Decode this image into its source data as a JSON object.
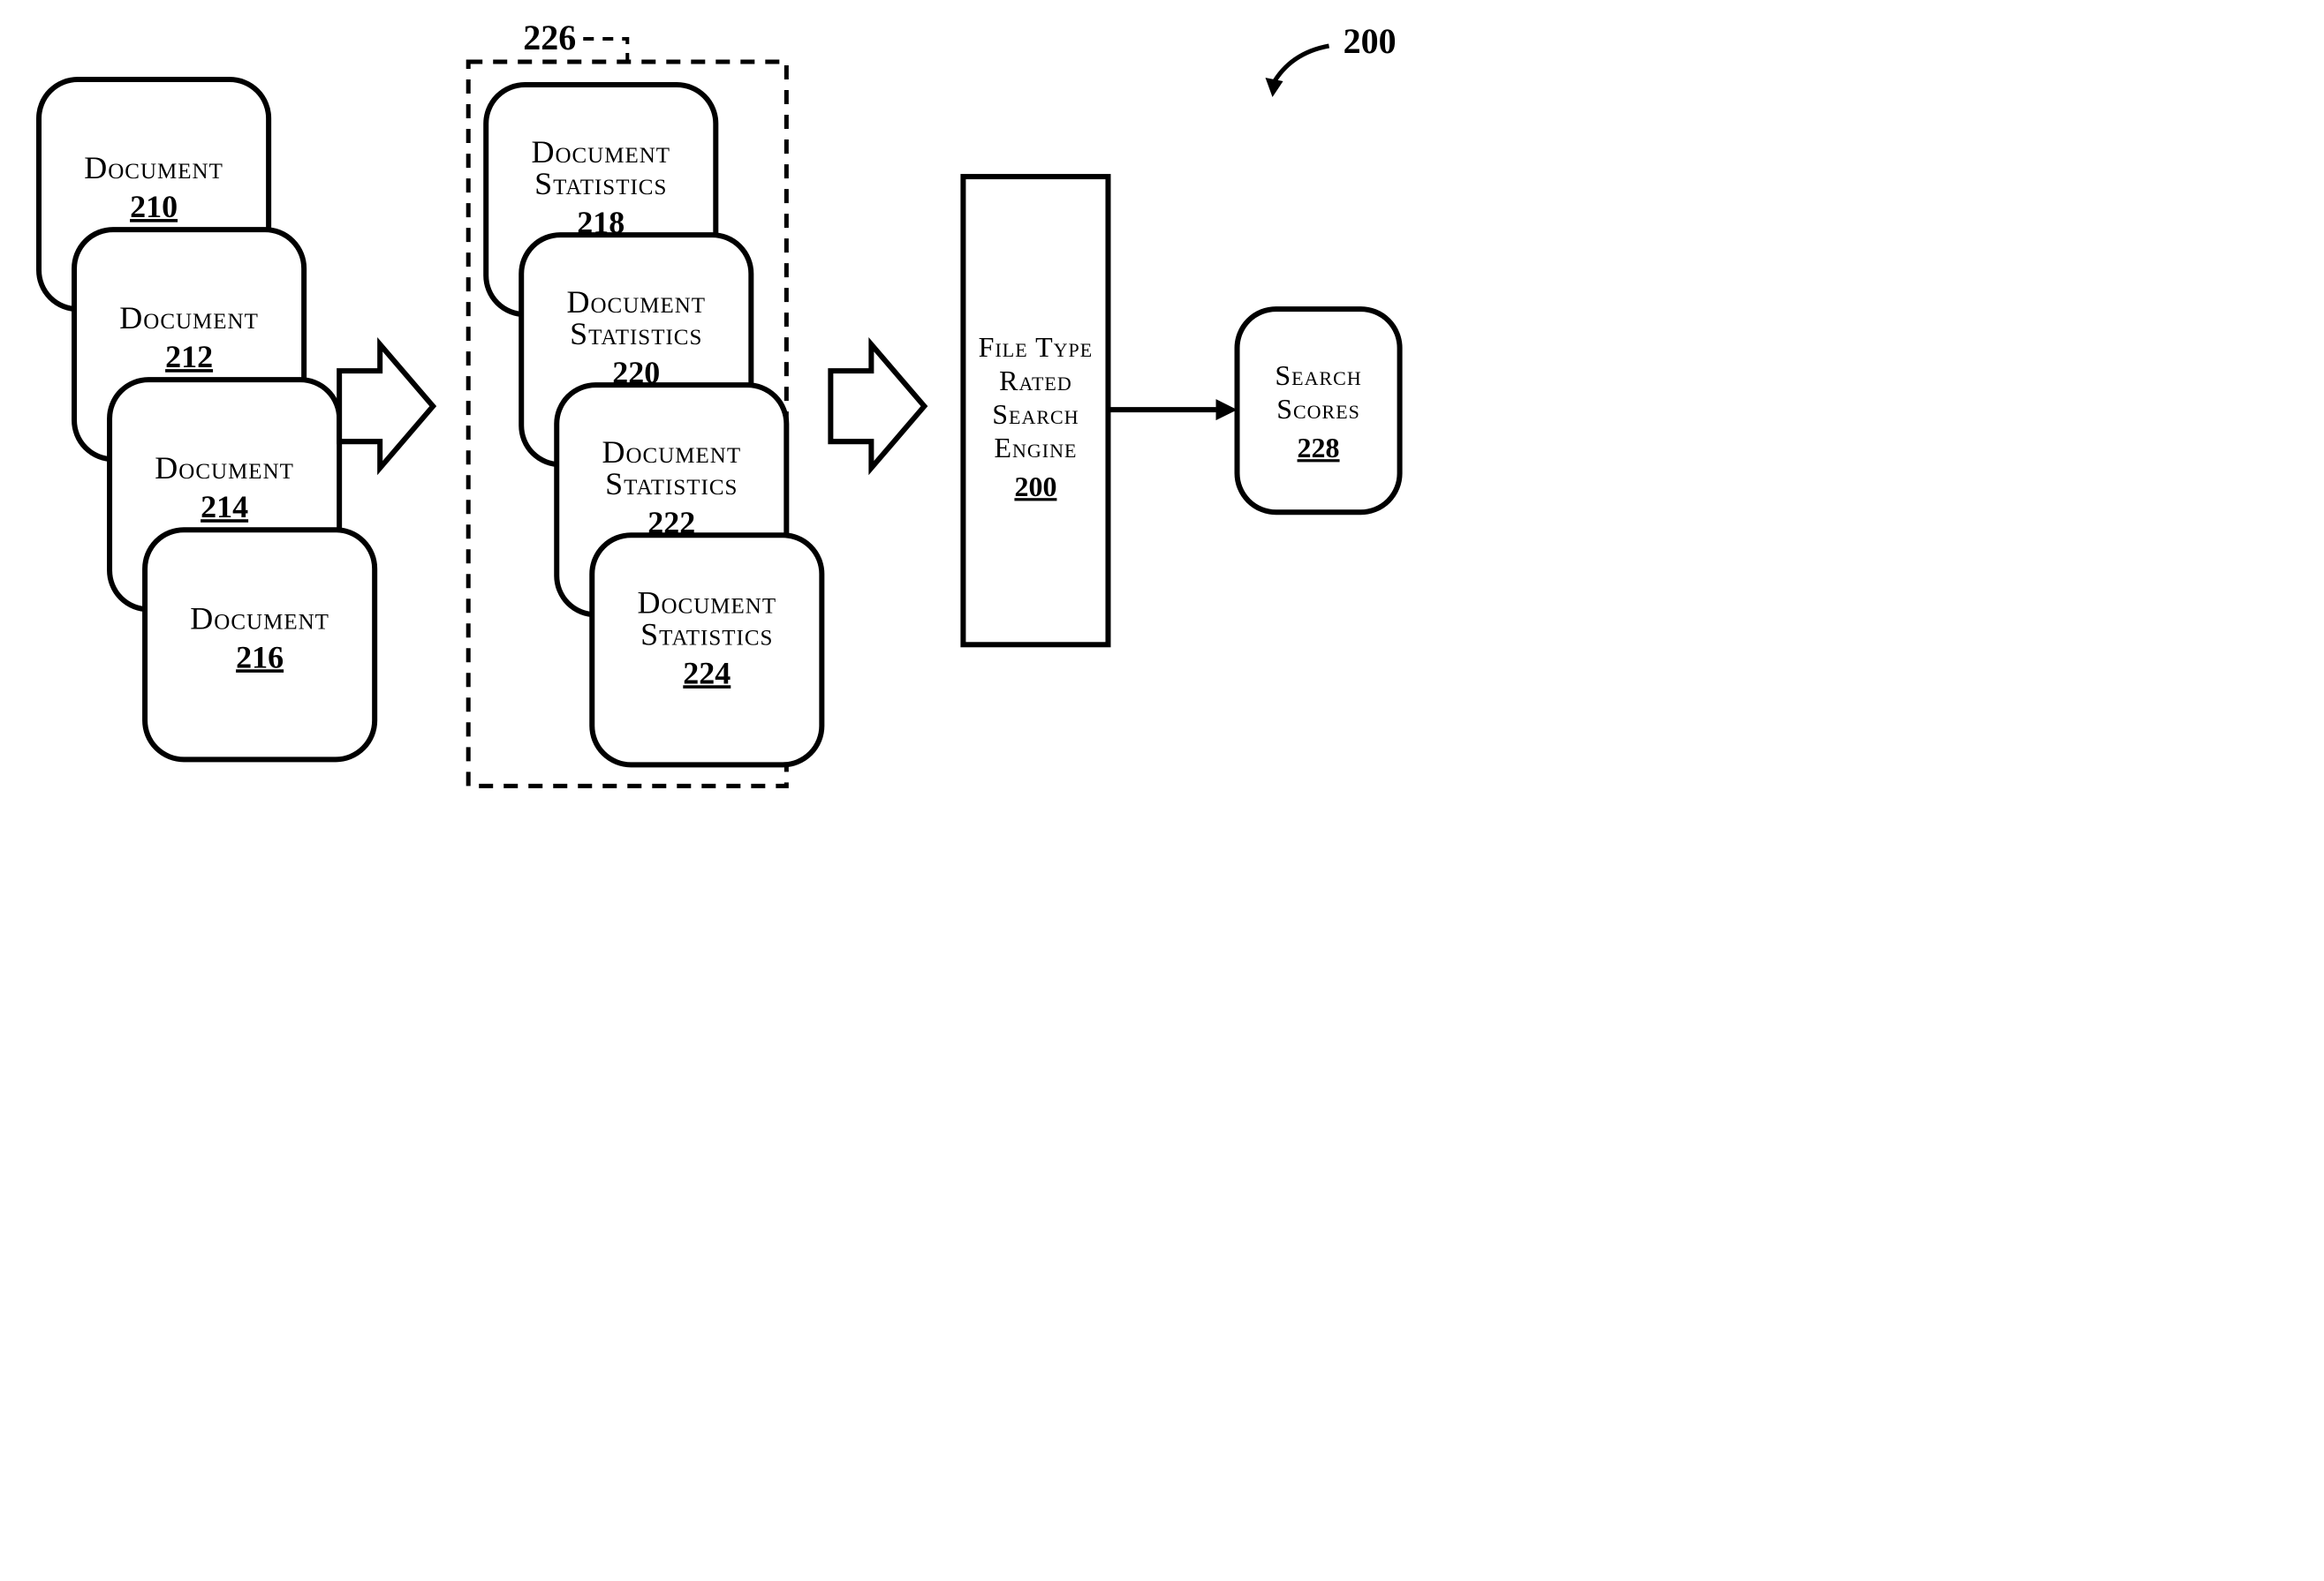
{
  "figure_ref_top": "200",
  "dashed_ref": "226",
  "documents": [
    {
      "label": "Document",
      "ref": "210"
    },
    {
      "label": "Document",
      "ref": "212"
    },
    {
      "label": "Document",
      "ref": "214"
    },
    {
      "label": "Document",
      "ref": "216"
    }
  ],
  "stats": [
    {
      "label1": "Document",
      "label2": "Statistics",
      "ref": "218"
    },
    {
      "label1": "Document",
      "label2": "Statistics",
      "ref": "220"
    },
    {
      "label1": "Document",
      "label2": "Statistics",
      "ref": "222"
    },
    {
      "label1": "Document",
      "label2": "Statistics",
      "ref": "224"
    }
  ],
  "engine": {
    "line1": "File Type",
    "line2": "Rated",
    "line3": "Search",
    "line4": "Engine",
    "ref": "200"
  },
  "output": {
    "line1": "Search",
    "line2": "Scores",
    "ref": "228"
  }
}
